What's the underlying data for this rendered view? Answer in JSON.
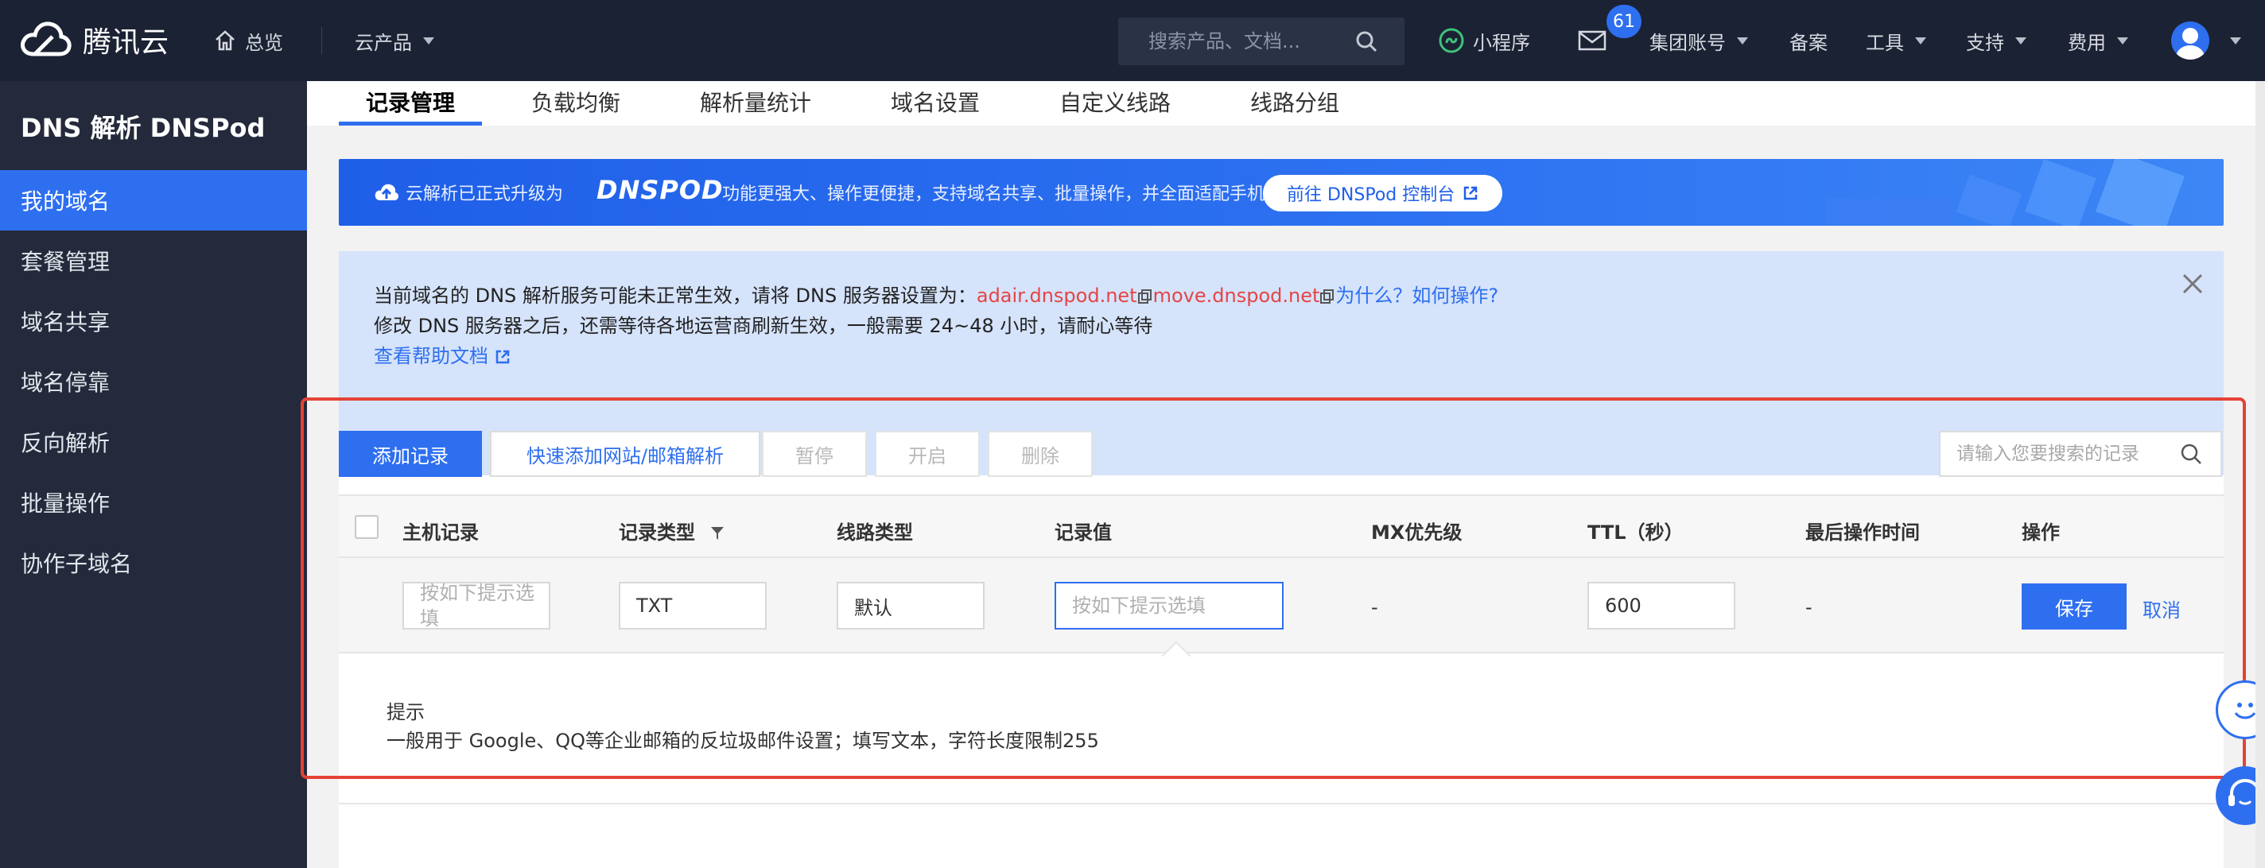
{
  "topbar": {
    "logo_text": "腾讯云",
    "overview": "总览",
    "products": "云产品",
    "search_placeholder": "搜索产品、文档...",
    "mini_program": "小程序",
    "mail_badge": "61",
    "group_account": "集团账号",
    "beian": "备案",
    "tools": "工具",
    "support": "支持",
    "fees": "费用"
  },
  "sidebar": {
    "title": "DNS 解析 DNSPod",
    "items": [
      {
        "label": "我的域名"
      },
      {
        "label": "套餐管理"
      },
      {
        "label": "域名共享"
      },
      {
        "label": "域名停靠"
      },
      {
        "label": "反向解析"
      },
      {
        "label": "批量操作"
      },
      {
        "label": "协作子域名"
      }
    ]
  },
  "tabs": [
    {
      "label": "记录管理"
    },
    {
      "label": "负载均衡"
    },
    {
      "label": "解析量统计"
    },
    {
      "label": "域名设置"
    },
    {
      "label": "自定义线路"
    },
    {
      "label": "线路分组"
    }
  ],
  "banner": {
    "prefix": "云解析已正式升级为",
    "brand": "DNSPOD",
    "desc": "功能更强大、操作更便捷，支持域名共享、批量操作，并全面适配手机端",
    "button": "前往 DNSPod 控制台"
  },
  "notice": {
    "line1_prefix": "当前域名的 DNS 解析服务可能未正常生效，请将 DNS 服务器设置为：",
    "ns1": "adair.dnspod.net",
    "ns2": "move.dnspod.net",
    "why": "为什么？如何操作?",
    "line2": "修改 DNS 服务器之后，还需等待各地运营商刷新生效，一般需要 24~48 小时，请耐心等待",
    "help": "查看帮助文档"
  },
  "toolbar": {
    "add": "添加记录",
    "quick_add": "快速添加网站/邮箱解析",
    "pause": "暂停",
    "enable": "开启",
    "delete": "删除",
    "search_placeholder": "请输入您要搜索的记录"
  },
  "table": {
    "headers": [
      "主机记录",
      "记录类型",
      "线路类型",
      "记录值",
      "MX优先级",
      "TTL（秒）",
      "最后操作时间",
      "操作"
    ],
    "row": {
      "host_placeholder": "按如下提示选填",
      "type": "TXT",
      "line": "默认",
      "value_placeholder": "按如下提示选填",
      "mx": "-",
      "ttl": "600",
      "last_time": "-",
      "save": "保存",
      "cancel": "取消"
    }
  },
  "tip": {
    "title": "提示",
    "text": "一般用于 Google、QQ等企业邮箱的反垃圾邮件设置；填写文本，字符长度限制255"
  },
  "colors": {
    "primary": "#2e6ff0",
    "topbar": "#1b2233",
    "sidebar": "#242a3b",
    "highlight_frame": "#e54236"
  }
}
